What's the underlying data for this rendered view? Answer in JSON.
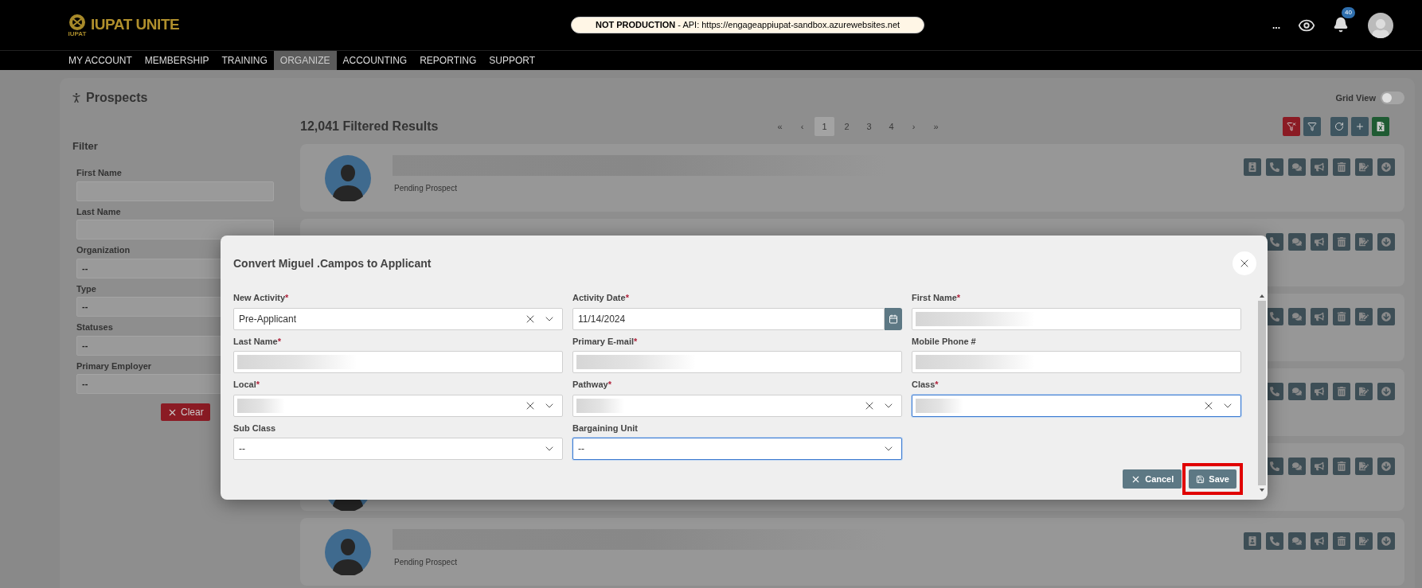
{
  "header": {
    "logo_text": "IUPAT UNITE",
    "logo_subtext": "IUPAT",
    "environment_banner": "**NOT PRODUCTION** - API: https://engageappiupat-sandbox.azurewebsites.net",
    "more": "...",
    "notification_count": "40"
  },
  "nav": [
    {
      "label": "MY ACCOUNT",
      "selected": false
    },
    {
      "label": "MEMBERSHIP",
      "selected": false
    },
    {
      "label": "TRAINING",
      "selected": false
    },
    {
      "label": "ORGANIZE",
      "selected": true
    },
    {
      "label": "ACCOUNTING",
      "selected": false
    },
    {
      "label": "REPORTING",
      "selected": false
    },
    {
      "label": "SUPPORT",
      "selected": false
    }
  ],
  "page": {
    "title": "Prospects",
    "grid_view": {
      "label": "Grid View",
      "on": false
    }
  },
  "filter": {
    "title": "Filter",
    "fields": [
      {
        "label": "First Name",
        "kind": "text"
      },
      {
        "label": "Last Name",
        "kind": "text"
      },
      {
        "label": "Organization",
        "kind": "select",
        "value": "--"
      },
      {
        "label": "Type",
        "kind": "select",
        "value": "--"
      },
      {
        "label": "Statuses",
        "kind": "select",
        "value": "--"
      },
      {
        "label": "Primary Employer",
        "kind": "select",
        "value": "--"
      }
    ],
    "clear_button": "Clear"
  },
  "results": {
    "count_label": "12,041 Filtered Results",
    "pagination": [
      {
        "label": "«",
        "selected": false
      },
      {
        "label": "‹",
        "selected": false
      },
      {
        "label": "1",
        "selected": true
      },
      {
        "label": "2",
        "selected": false
      },
      {
        "label": "3",
        "selected": false
      },
      {
        "label": "4",
        "selected": false
      },
      {
        "label": "›",
        "selected": false
      },
      {
        "label": "»",
        "selected": false
      }
    ],
    "toolbar": [
      {
        "kind": "clear-filter",
        "color": "#8b1b24"
      },
      {
        "kind": "filter",
        "color": "#3e5560"
      },
      {
        "kind": "refresh",
        "color": "#3e5560"
      },
      {
        "kind": "add",
        "color": "#3e5560"
      },
      {
        "kind": "export",
        "color": "#1f5b33"
      }
    ],
    "cards": [
      {
        "kind": "prospect",
        "status": "Pending Prospect"
      },
      {
        "kind": "covered"
      },
      {
        "kind": "covered"
      },
      {
        "kind": "covered"
      },
      {
        "kind": "covered-avatar"
      },
      {
        "kind": "prospect",
        "status": "Pending Prospect"
      }
    ]
  },
  "modal": {
    "title": "Convert Miguel .Campos to Applicant",
    "fields": [
      {
        "label": "New Activity",
        "marker": "*",
        "kind": "select",
        "value": "Pre-Applicant",
        "clearable": true,
        "focused": false
      },
      {
        "label": "Activity Date",
        "marker": "*",
        "kind": "date",
        "value": "11/14/2024",
        "focused": false
      },
      {
        "label": "First Name",
        "marker": "*",
        "kind": "text",
        "blurred": true,
        "focused": false
      },
      {
        "label": "Last Name",
        "marker": "*",
        "kind": "text",
        "blurred": true,
        "focused": false
      },
      {
        "label": "Primary E-mail",
        "marker": "*",
        "kind": "text",
        "blurred": true,
        "focused": false
      },
      {
        "label": "Mobile Phone #",
        "kind": "text",
        "blurred": true,
        "focused": false
      },
      {
        "label": "Local",
        "marker": "*",
        "kind": "select",
        "blurred": true,
        "clearable": true,
        "focused": false
      },
      {
        "label": "Pathway",
        "marker": "*",
        "kind": "select",
        "blurred": true,
        "clearable": true,
        "focused": false
      },
      {
        "label": "Class",
        "marker": "*",
        "kind": "select",
        "blurred": true,
        "clearable": true,
        "focused": true
      },
      {
        "label": "Sub Class",
        "kind": "select",
        "value": "--",
        "clearable": false,
        "focused": false
      },
      {
        "label": "Bargaining Unit",
        "kind": "select",
        "value": "--",
        "clearable": false,
        "focused": true
      }
    ],
    "cancel_button": "Cancel",
    "save_button": {
      "label": "Save",
      "annotated": true
    }
  }
}
